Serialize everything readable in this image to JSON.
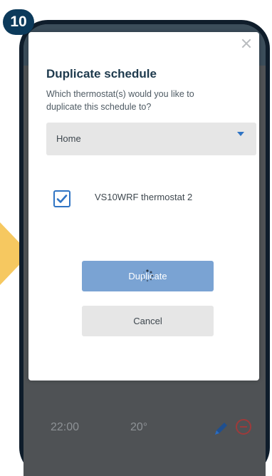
{
  "step": {
    "number": "10",
    "badge_color": "#0c3a5b",
    "arrow_color": "#f6c860"
  },
  "background_row": {
    "time": "22:00",
    "temp": "20°",
    "edit_icon": "pencil-icon",
    "remove_icon": "minus-circle-icon"
  },
  "dialog": {
    "close_icon": "close-icon",
    "title": "Duplicate schedule",
    "subtitle": "Which thermostat(s) would you like to duplicate this schedule to?",
    "select": {
      "value": "Home",
      "caret_icon": "caret-down-icon"
    },
    "thermostat_option": {
      "label": "VS10WRF thermostat 2",
      "checked": true
    },
    "duplicate_label": "Duplicate",
    "cancel_label": "Cancel",
    "accent": "#2f74c4",
    "primary_button_color": "#7aa3d3"
  }
}
